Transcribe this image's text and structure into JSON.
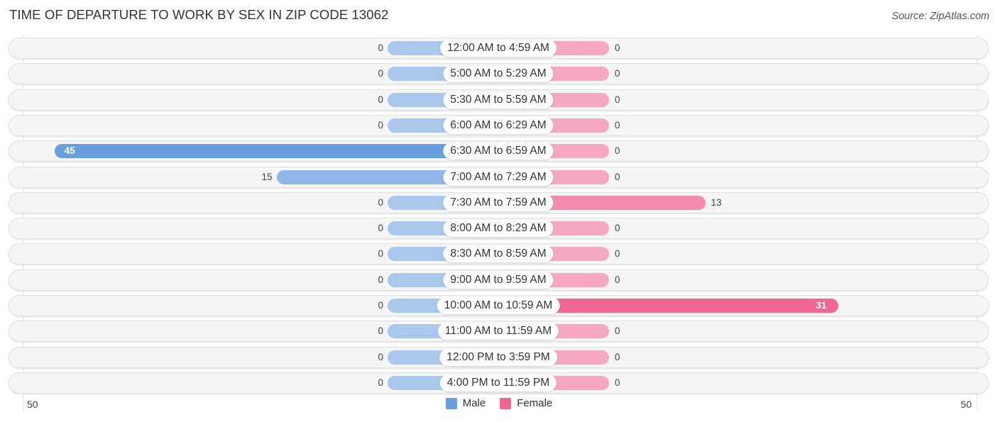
{
  "header": {
    "title": "TIME OF DEPARTURE TO WORK BY SEX IN ZIP CODE 13062",
    "source": "Source: ZipAtlas.com"
  },
  "colors": {
    "male": "#6a9fdf",
    "male_light": "#a9c8ec",
    "female": "#f06892",
    "female_light": "#f6a8c1"
  },
  "chart_data": {
    "type": "bar",
    "orientation": "horizontal-diverging",
    "title": "TIME OF DEPARTURE TO WORK BY SEX IN ZIP CODE 13062",
    "categories": [
      "12:00 AM to 4:59 AM",
      "5:00 AM to 5:29 AM",
      "5:30 AM to 5:59 AM",
      "6:00 AM to 6:29 AM",
      "6:30 AM to 6:59 AM",
      "7:00 AM to 7:29 AM",
      "7:30 AM to 7:59 AM",
      "8:00 AM to 8:29 AM",
      "8:30 AM to 8:59 AM",
      "9:00 AM to 9:59 AM",
      "10:00 AM to 10:59 AM",
      "11:00 AM to 11:59 AM",
      "12:00 PM to 3:59 PM",
      "4:00 PM to 11:59 PM"
    ],
    "series": [
      {
        "name": "Male",
        "values": [
          0,
          0,
          0,
          0,
          45,
          15,
          0,
          0,
          0,
          0,
          0,
          0,
          0,
          0
        ]
      },
      {
        "name": "Female",
        "values": [
          0,
          0,
          0,
          0,
          0,
          0,
          13,
          0,
          0,
          0,
          31,
          0,
          0,
          0
        ]
      }
    ],
    "axis": {
      "left_label": "50",
      "right_label": "50",
      "range": [
        -50,
        50
      ]
    },
    "legend": {
      "position": "bottom-center",
      "entries": [
        "Male",
        "Female"
      ]
    },
    "xlabel": "",
    "ylabel": ""
  }
}
